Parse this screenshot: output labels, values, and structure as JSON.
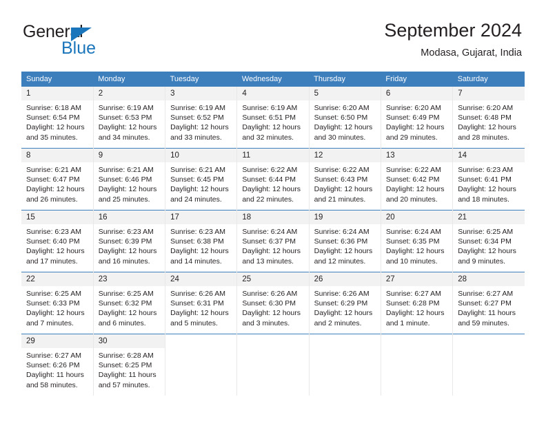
{
  "brand": {
    "name_dark": "General",
    "name_blue": "Blue",
    "accent_color": "#1b75bb",
    "header_color": "#3d7ebd"
  },
  "header": {
    "title": "September 2024",
    "subtitle": "Modasa, Gujarat, India"
  },
  "weekday_headers": [
    "Sunday",
    "Monday",
    "Tuesday",
    "Wednesday",
    "Thursday",
    "Friday",
    "Saturday"
  ],
  "labels": {
    "sunrise_prefix": "Sunrise:",
    "sunset_prefix": "Sunset:",
    "daylight_prefix": "Daylight:"
  },
  "weeks": [
    [
      {
        "day": "1",
        "sunrise": "Sunrise: 6:18 AM",
        "sunset": "Sunset: 6:54 PM",
        "daylight_line1": "Daylight: 12 hours",
        "daylight_line2": "and 35 minutes."
      },
      {
        "day": "2",
        "sunrise": "Sunrise: 6:19 AM",
        "sunset": "Sunset: 6:53 PM",
        "daylight_line1": "Daylight: 12 hours",
        "daylight_line2": "and 34 minutes."
      },
      {
        "day": "3",
        "sunrise": "Sunrise: 6:19 AM",
        "sunset": "Sunset: 6:52 PM",
        "daylight_line1": "Daylight: 12 hours",
        "daylight_line2": "and 33 minutes."
      },
      {
        "day": "4",
        "sunrise": "Sunrise: 6:19 AM",
        "sunset": "Sunset: 6:51 PM",
        "daylight_line1": "Daylight: 12 hours",
        "daylight_line2": "and 32 minutes."
      },
      {
        "day": "5",
        "sunrise": "Sunrise: 6:20 AM",
        "sunset": "Sunset: 6:50 PM",
        "daylight_line1": "Daylight: 12 hours",
        "daylight_line2": "and 30 minutes."
      },
      {
        "day": "6",
        "sunrise": "Sunrise: 6:20 AM",
        "sunset": "Sunset: 6:49 PM",
        "daylight_line1": "Daylight: 12 hours",
        "daylight_line2": "and 29 minutes."
      },
      {
        "day": "7",
        "sunrise": "Sunrise: 6:20 AM",
        "sunset": "Sunset: 6:48 PM",
        "daylight_line1": "Daylight: 12 hours",
        "daylight_line2": "and 28 minutes."
      }
    ],
    [
      {
        "day": "8",
        "sunrise": "Sunrise: 6:21 AM",
        "sunset": "Sunset: 6:47 PM",
        "daylight_line1": "Daylight: 12 hours",
        "daylight_line2": "and 26 minutes."
      },
      {
        "day": "9",
        "sunrise": "Sunrise: 6:21 AM",
        "sunset": "Sunset: 6:46 PM",
        "daylight_line1": "Daylight: 12 hours",
        "daylight_line2": "and 25 minutes."
      },
      {
        "day": "10",
        "sunrise": "Sunrise: 6:21 AM",
        "sunset": "Sunset: 6:45 PM",
        "daylight_line1": "Daylight: 12 hours",
        "daylight_line2": "and 24 minutes."
      },
      {
        "day": "11",
        "sunrise": "Sunrise: 6:22 AM",
        "sunset": "Sunset: 6:44 PM",
        "daylight_line1": "Daylight: 12 hours",
        "daylight_line2": "and 22 minutes."
      },
      {
        "day": "12",
        "sunrise": "Sunrise: 6:22 AM",
        "sunset": "Sunset: 6:43 PM",
        "daylight_line1": "Daylight: 12 hours",
        "daylight_line2": "and 21 minutes."
      },
      {
        "day": "13",
        "sunrise": "Sunrise: 6:22 AM",
        "sunset": "Sunset: 6:42 PM",
        "daylight_line1": "Daylight: 12 hours",
        "daylight_line2": "and 20 minutes."
      },
      {
        "day": "14",
        "sunrise": "Sunrise: 6:23 AM",
        "sunset": "Sunset: 6:41 PM",
        "daylight_line1": "Daylight: 12 hours",
        "daylight_line2": "and 18 minutes."
      }
    ],
    [
      {
        "day": "15",
        "sunrise": "Sunrise: 6:23 AM",
        "sunset": "Sunset: 6:40 PM",
        "daylight_line1": "Daylight: 12 hours",
        "daylight_line2": "and 17 minutes."
      },
      {
        "day": "16",
        "sunrise": "Sunrise: 6:23 AM",
        "sunset": "Sunset: 6:39 PM",
        "daylight_line1": "Daylight: 12 hours",
        "daylight_line2": "and 16 minutes."
      },
      {
        "day": "17",
        "sunrise": "Sunrise: 6:23 AM",
        "sunset": "Sunset: 6:38 PM",
        "daylight_line1": "Daylight: 12 hours",
        "daylight_line2": "and 14 minutes."
      },
      {
        "day": "18",
        "sunrise": "Sunrise: 6:24 AM",
        "sunset": "Sunset: 6:37 PM",
        "daylight_line1": "Daylight: 12 hours",
        "daylight_line2": "and 13 minutes."
      },
      {
        "day": "19",
        "sunrise": "Sunrise: 6:24 AM",
        "sunset": "Sunset: 6:36 PM",
        "daylight_line1": "Daylight: 12 hours",
        "daylight_line2": "and 12 minutes."
      },
      {
        "day": "20",
        "sunrise": "Sunrise: 6:24 AM",
        "sunset": "Sunset: 6:35 PM",
        "daylight_line1": "Daylight: 12 hours",
        "daylight_line2": "and 10 minutes."
      },
      {
        "day": "21",
        "sunrise": "Sunrise: 6:25 AM",
        "sunset": "Sunset: 6:34 PM",
        "daylight_line1": "Daylight: 12 hours",
        "daylight_line2": "and 9 minutes."
      }
    ],
    [
      {
        "day": "22",
        "sunrise": "Sunrise: 6:25 AM",
        "sunset": "Sunset: 6:33 PM",
        "daylight_line1": "Daylight: 12 hours",
        "daylight_line2": "and 7 minutes."
      },
      {
        "day": "23",
        "sunrise": "Sunrise: 6:25 AM",
        "sunset": "Sunset: 6:32 PM",
        "daylight_line1": "Daylight: 12 hours",
        "daylight_line2": "and 6 minutes."
      },
      {
        "day": "24",
        "sunrise": "Sunrise: 6:26 AM",
        "sunset": "Sunset: 6:31 PM",
        "daylight_line1": "Daylight: 12 hours",
        "daylight_line2": "and 5 minutes."
      },
      {
        "day": "25",
        "sunrise": "Sunrise: 6:26 AM",
        "sunset": "Sunset: 6:30 PM",
        "daylight_line1": "Daylight: 12 hours",
        "daylight_line2": "and 3 minutes."
      },
      {
        "day": "26",
        "sunrise": "Sunrise: 6:26 AM",
        "sunset": "Sunset: 6:29 PM",
        "daylight_line1": "Daylight: 12 hours",
        "daylight_line2": "and 2 minutes."
      },
      {
        "day": "27",
        "sunrise": "Sunrise: 6:27 AM",
        "sunset": "Sunset: 6:28 PM",
        "daylight_line1": "Daylight: 12 hours",
        "daylight_line2": "and 1 minute."
      },
      {
        "day": "28",
        "sunrise": "Sunrise: 6:27 AM",
        "sunset": "Sunset: 6:27 PM",
        "daylight_line1": "Daylight: 11 hours",
        "daylight_line2": "and 59 minutes."
      }
    ],
    [
      {
        "day": "29",
        "sunrise": "Sunrise: 6:27 AM",
        "sunset": "Sunset: 6:26 PM",
        "daylight_line1": "Daylight: 11 hours",
        "daylight_line2": "and 58 minutes."
      },
      {
        "day": "30",
        "sunrise": "Sunrise: 6:28 AM",
        "sunset": "Sunset: 6:25 PM",
        "daylight_line1": "Daylight: 11 hours",
        "daylight_line2": "and 57 minutes."
      },
      {
        "day": "",
        "sunrise": "",
        "sunset": "",
        "daylight_line1": "",
        "daylight_line2": ""
      },
      {
        "day": "",
        "sunrise": "",
        "sunset": "",
        "daylight_line1": "",
        "daylight_line2": ""
      },
      {
        "day": "",
        "sunrise": "",
        "sunset": "",
        "daylight_line1": "",
        "daylight_line2": ""
      },
      {
        "day": "",
        "sunrise": "",
        "sunset": "",
        "daylight_line1": "",
        "daylight_line2": ""
      },
      {
        "day": "",
        "sunrise": "",
        "sunset": "",
        "daylight_line1": "",
        "daylight_line2": ""
      }
    ]
  ]
}
